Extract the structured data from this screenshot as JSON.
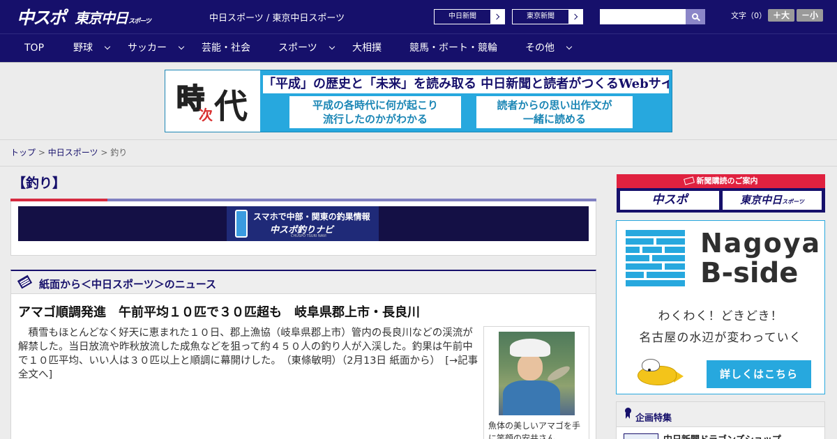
{
  "header": {
    "logo_main": "中スポ",
    "logo_sub": "東京中日",
    "logo_sub_small": "スポーツ",
    "site_names": "中日スポーツ / 東京中日スポーツ",
    "paper_links": [
      "中日新聞",
      "東京新聞"
    ],
    "search_placeholder": "",
    "font_size_label": "文字（0）",
    "font_larger": "＋大",
    "font_smaller": "－小"
  },
  "nav": {
    "items": [
      {
        "label": "TOP"
      },
      {
        "label": "野球"
      },
      {
        "label": "サッカー"
      },
      {
        "label": "芸能・社会"
      },
      {
        "label": "スポーツ"
      },
      {
        "label": "大相撲"
      },
      {
        "label": "競馬・ボート・競輪"
      },
      {
        "label": "その他"
      }
    ]
  },
  "banner": {
    "char1": "時",
    "char2": "次",
    "char3": "代",
    "headline": "「平成」の歴史と「未来」を読み取る 中日新聞と読者がつくるWebサイト",
    "box1_line1": "平成の各時代に何が起こり",
    "box1_line2": "流行したのかがわかる",
    "box2_line1": "読者からの思い出作文が",
    "box2_line2": "一緒に読める"
  },
  "breadcrumb": {
    "home": "トップ",
    "section": "中日スポーツ",
    "current": "釣り",
    "separator": ">"
  },
  "main": {
    "page_title": "【釣り】",
    "promo": {
      "line1": "スマホで中部・関東の釣果情報",
      "line2": "中スポ釣りナビ",
      "line3": "CHUSPO TSURI NAVI"
    },
    "news": {
      "section_title": "紙面から＜中日スポーツ＞のニュース",
      "article_title": "アマゴ順調発進　午前平均１０匹で３０匹超も　岐阜県郡上市・長良川",
      "article_body": "　積雪もほとんどなく好天に恵まれた１０日、郡上漁協（岐阜県郡上市）管内の長良川などの渓流が解禁した。当日放流や昨秋放流した成魚などを狙って約４５０人の釣り人が入渓した。釣果は午前中で１０匹平均、いい人は３０匹以上と順調に幕開けした。　（東條敏明）（2月13日 紙面から）　[→記事全文へ]",
      "photo_caption": "魚体の美しいアマゴを手に笑顔の安井さん"
    }
  },
  "sidebar": {
    "subscribe": {
      "header": "新聞購読のご案内",
      "btn1": "中スポ",
      "btn2": "東京中日",
      "btn2_small": "スポーツ"
    },
    "nagoya": {
      "title1": "Nagoya",
      "title2": "B-side",
      "text1": "わくわく！どきどき！",
      "text2": "名古屋の水辺が変わっていく",
      "button": "詳しくはこちら"
    },
    "kikaku": {
      "title": "企画特集",
      "item1": "中日新聞ドラゴンズショップ"
    }
  },
  "colors": {
    "navy": "#16106b",
    "accent_blue": "#27a8de",
    "accent_red": "#e0213f"
  }
}
